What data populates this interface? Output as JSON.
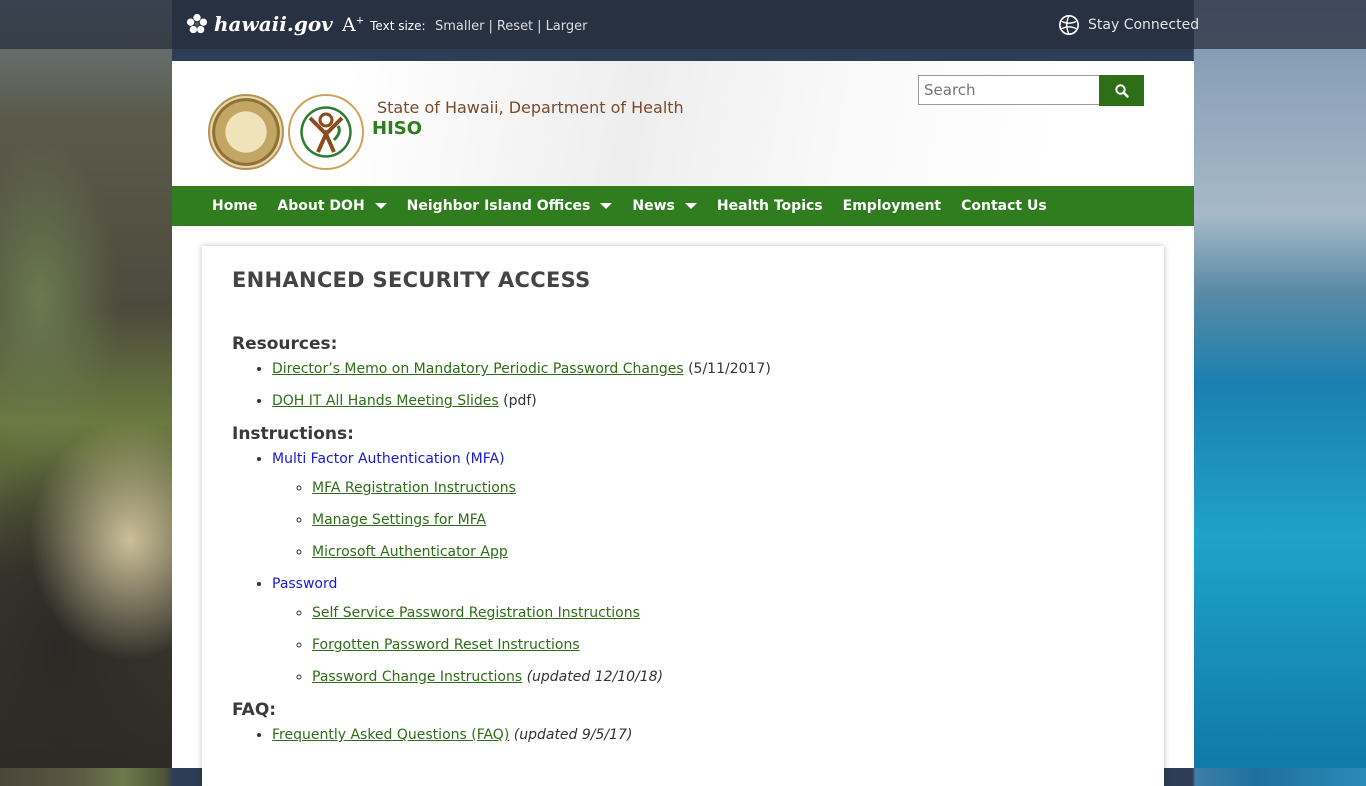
{
  "topbar": {
    "site": "hawaii.gov",
    "text_size_label": "Text size:",
    "smaller": "Smaller",
    "reset": "Reset",
    "larger": "Larger",
    "separator": "|",
    "stay_connected": "Stay Connected"
  },
  "header": {
    "org": "State of Hawaii, Department of Health",
    "site": "HISO",
    "search_placeholder": "Search"
  },
  "nav": {
    "items": [
      {
        "label": "Home"
      },
      {
        "label": "About DOH"
      },
      {
        "label": "Neighbor Island Offices"
      },
      {
        "label": "News"
      },
      {
        "label": "Health Topics"
      },
      {
        "label": "Employment"
      },
      {
        "label": "Contact Us"
      }
    ]
  },
  "page": {
    "title": "ENHANCED SECURITY ACCESS",
    "resources": {
      "heading": "Resources:",
      "items": [
        {
          "link": "Director’s Memo on Mandatory Periodic Password Changes",
          "note": "(5/11/2017)"
        },
        {
          "link": "DOH IT All Hands Meeting Slides",
          "note": "(pdf)"
        }
      ]
    },
    "instructions": {
      "heading": "Instructions:",
      "groups": [
        {
          "label": "Multi Factor Authentication (MFA)",
          "items": [
            {
              "link": "MFA Registration Instructions"
            },
            {
              "link": "Manage Settings for MFA"
            },
            {
              "link": "Microsoft Authenticator App"
            }
          ]
        },
        {
          "label": "Password",
          "items": [
            {
              "link": "Self Service Password Registration Instructions"
            },
            {
              "link": "Forgotten Password Reset Instructions"
            },
            {
              "link": "Password Change Instructions",
              "note": "(updated 12/10/18)"
            }
          ]
        }
      ]
    },
    "faq": {
      "heading": "FAQ:",
      "items": [
        {
          "link": "Frequently Asked Questions (FAQ)",
          "note": "(updated 9/5/17)"
        }
      ]
    }
  },
  "colors": {
    "nav_green": "#2f7d1e",
    "link_green": "#2e6e17",
    "sub_blue": "#1a1ad0"
  }
}
